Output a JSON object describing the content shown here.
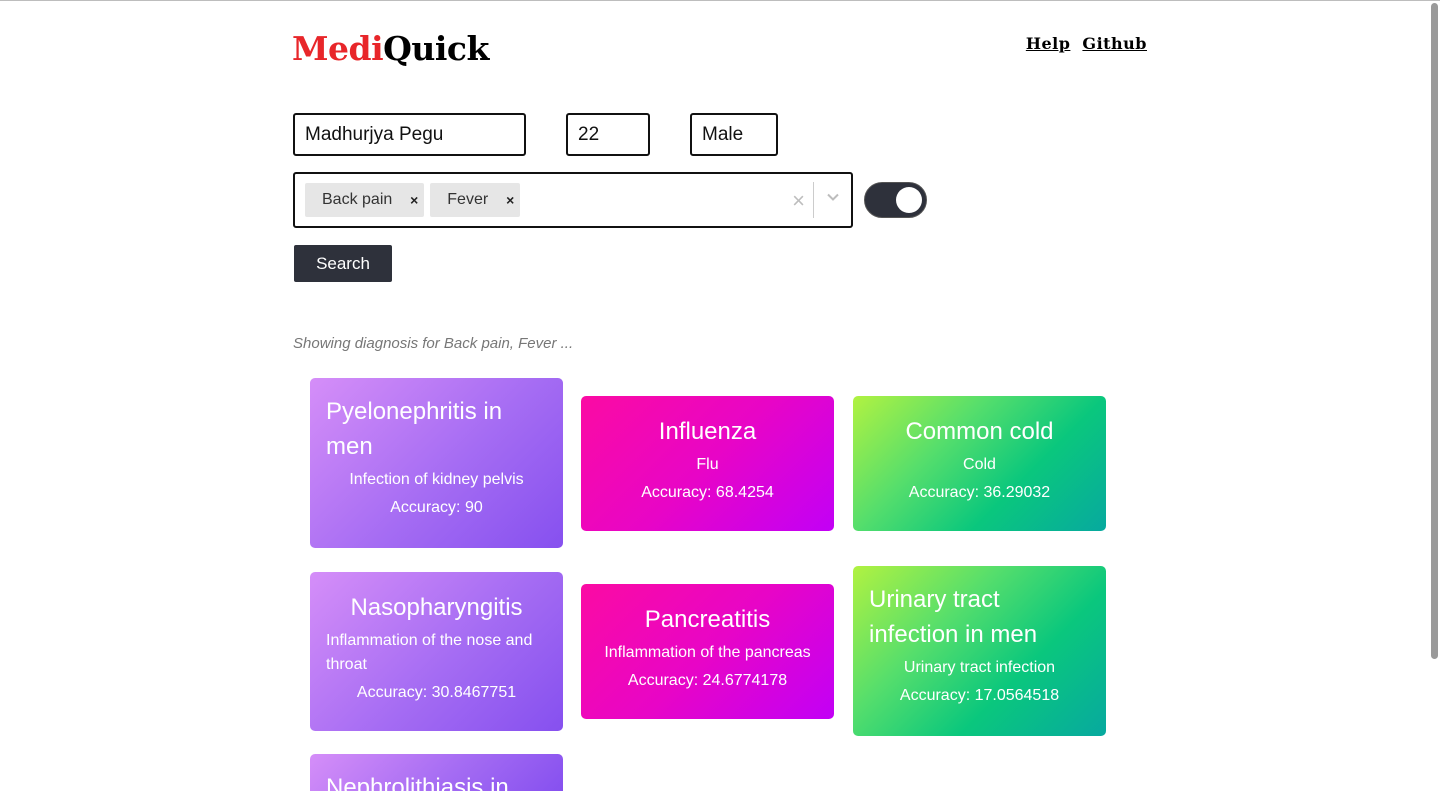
{
  "header": {
    "logo_part1": "Medi",
    "logo_part2": "Quick",
    "nav": [
      "Help",
      "Github"
    ]
  },
  "form": {
    "name_value": "Madhurjya Pegu",
    "age_value": "22",
    "sex_value": "Male",
    "symptoms": [
      "Back pain",
      "Fever"
    ],
    "clear_glyph": "×",
    "remove_glyph": "×",
    "toggle_on": true,
    "search_label": "Search"
  },
  "status_text": "Showing diagnosis for Back pain, Fever ...",
  "results": [
    {
      "title": "Pyelonephritis in men",
      "desc": "Infection of kidney pelvis",
      "accuracy": "Accuracy: 90"
    },
    {
      "title": "Influenza",
      "desc": "Flu",
      "accuracy": "Accuracy: 68.4254"
    },
    {
      "title": "Common cold",
      "desc": "Cold",
      "accuracy": "Accuracy: 36.29032"
    },
    {
      "title": "Nasopharyngitis",
      "desc": "Inflammation of the nose and throat",
      "accuracy": "Accuracy: 30.8467751"
    },
    {
      "title": "Pancreatitis",
      "desc": "Inflammation of the pancreas",
      "accuracy": "Accuracy: 24.6774178"
    },
    {
      "title": "Urinary tract infection in men",
      "desc": "Urinary tract infection",
      "accuracy": "Accuracy: 17.0564518"
    },
    {
      "title": "Nephrolithiasis in"
    }
  ],
  "colors": {
    "logo_red": "#e8262a",
    "dark": "#2e313b",
    "purple": "#a56cf3",
    "pink": "#e805c6",
    "green": "#0ac77d"
  }
}
